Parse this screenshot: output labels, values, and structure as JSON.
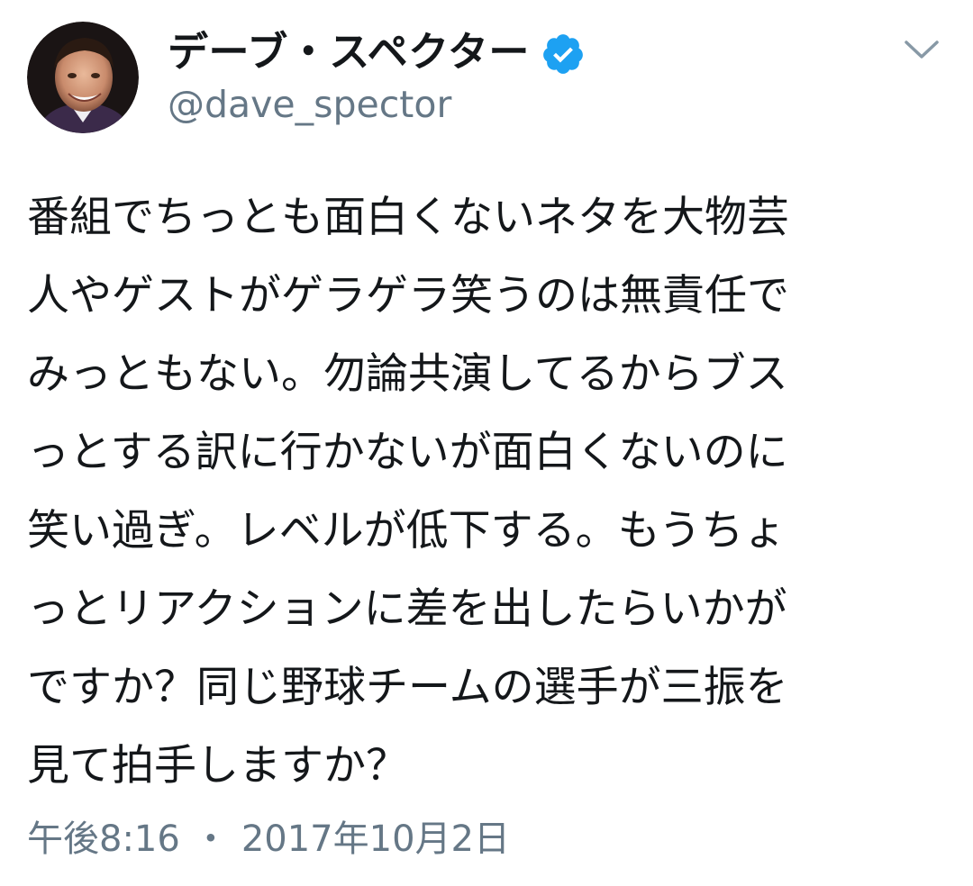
{
  "author": {
    "display_name": "デーブ・スペクター",
    "handle": "@dave_spector",
    "verified": true
  },
  "tweet": {
    "text": "番組でちっとも面白くないネタを大物芸\n人やゲストがゲラゲラ笑うのは無責任で\nみっともない。勿論共演してるからブス\nっとする訳に行かないが面白くないのに\n笑い過ぎ。レベルが低下する。もうちょ\nっとリアクションに差を出したらいかが\nですか？同じ野球チームの選手が三振を\n見て拍手しますか？",
    "time": "午後8:16",
    "separator": "・",
    "date": "2017年10月2日"
  },
  "icons": {
    "verified": "verified-badge-icon",
    "menu": "chevron-down-icon"
  },
  "colors": {
    "text": "#14171a",
    "secondary": "#657786",
    "verified_blue": "#1da1f2",
    "background": "#ffffff"
  }
}
